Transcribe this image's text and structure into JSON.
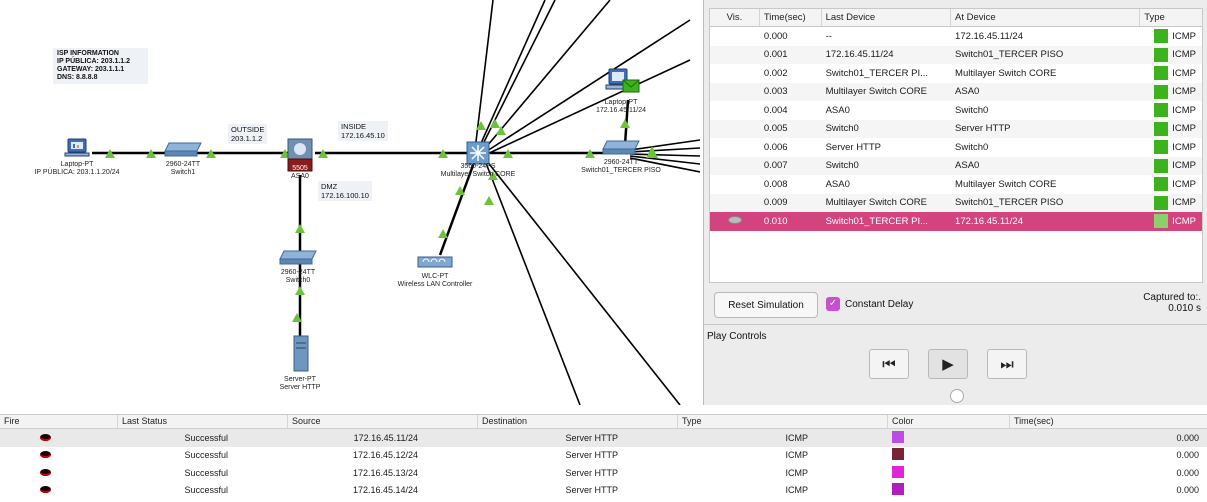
{
  "topology": {
    "isp_note": [
      "ISP INFORMATION",
      "IP PÚBLICA: 203.1.1.2",
      "GATEWAY: 203.1.1.1",
      "DNS: 8.8.8.8"
    ],
    "outside": [
      "OUTSIDE",
      "203.1.1.2"
    ],
    "inside": [
      "INSIDE",
      "172.16.45.10"
    ],
    "dmz": [
      "DMZ",
      "172.16.100.10"
    ],
    "devices": {
      "laptop_left": [
        "Laptop-PT",
        "IP PÚBLICA: 203.1.1.20/24"
      ],
      "switch1": [
        "2960-24TT",
        "Switch1"
      ],
      "asa0": [
        "5505",
        "ASA0"
      ],
      "switch0": [
        "2960-24TT",
        "Switch0"
      ],
      "server": [
        "Server-PT",
        "Server HTTP"
      ],
      "mlswitch": [
        "3560-24PS",
        "Multilayer Switch CORE"
      ],
      "wlc": [
        "WLC-PT",
        "Wireless LAN Controller"
      ],
      "laptop_top": [
        "Laptop-PT",
        "172.16.45.11/24"
      ],
      "switch01": [
        "2960-24TT",
        "Switch01_TERCER PISO"
      ]
    }
  },
  "event_list": {
    "columns": [
      "Vis.",
      "Time(sec)",
      "Last Device",
      "At Device",
      "Type"
    ],
    "rows": [
      {
        "time": "0.000",
        "last": "--",
        "at": "172.16.45.11/24",
        "type": "ICMP"
      },
      {
        "time": "0.001",
        "last": "172.16.45.11/24",
        "at": "Switch01_TERCER PISO",
        "type": "ICMP"
      },
      {
        "time": "0.002",
        "last": "Switch01_TERCER PI...",
        "at": "Multilayer Switch CORE",
        "type": "ICMP"
      },
      {
        "time": "0.003",
        "last": "Multilayer Switch CORE",
        "at": "ASA0",
        "type": "ICMP"
      },
      {
        "time": "0.004",
        "last": "ASA0",
        "at": "Switch0",
        "type": "ICMP"
      },
      {
        "time": "0.005",
        "last": "Switch0",
        "at": "Server HTTP",
        "type": "ICMP"
      },
      {
        "time": "0.006",
        "last": "Server HTTP",
        "at": "Switch0",
        "type": "ICMP"
      },
      {
        "time": "0.007",
        "last": "Switch0",
        "at": "ASA0",
        "type": "ICMP"
      },
      {
        "time": "0.008",
        "last": "ASA0",
        "at": "Multilayer Switch CORE",
        "type": "ICMP"
      },
      {
        "time": "0.009",
        "last": "Multilayer Switch CORE",
        "at": "Switch01_TERCER PISO",
        "type": "ICMP"
      },
      {
        "time": "0.010",
        "last": "Switch01_TERCER PI...",
        "at": "172.16.45.11/24",
        "type": "ICMP",
        "selected": true
      }
    ],
    "type_color": "#3cb21c",
    "selected_color": "#d3437d"
  },
  "controls": {
    "reset_label": "Reset Simulation",
    "constant_delay_label": "Constant Delay",
    "constant_delay_checked": true,
    "captured_label": "Captured to:.",
    "captured_value": "0.010 s",
    "play_title": "Play Controls"
  },
  "pdu_list": {
    "columns": [
      "Fire",
      "Last Status",
      "Source",
      "Destination",
      "Type",
      "Color",
      "Time(sec)"
    ],
    "rows": [
      {
        "status": "Successful",
        "source": "172.16.45.11/24",
        "destination": "Server HTTP",
        "type": "ICMP",
        "color": "#b94ee0",
        "time": "0.000"
      },
      {
        "status": "Successful",
        "source": "172.16.45.12/24",
        "destination": "Server HTTP",
        "type": "ICMP",
        "color": "#7a2236",
        "time": "0.000"
      },
      {
        "status": "Successful",
        "source": "172.16.45.13/24",
        "destination": "Server HTTP",
        "type": "ICMP",
        "color": "#e024d8",
        "time": "0.000"
      },
      {
        "status": "Successful",
        "source": "172.16.45.14/24",
        "destination": "Server HTTP",
        "type": "ICMP",
        "color": "#b01ec0",
        "time": "0.000"
      }
    ]
  }
}
